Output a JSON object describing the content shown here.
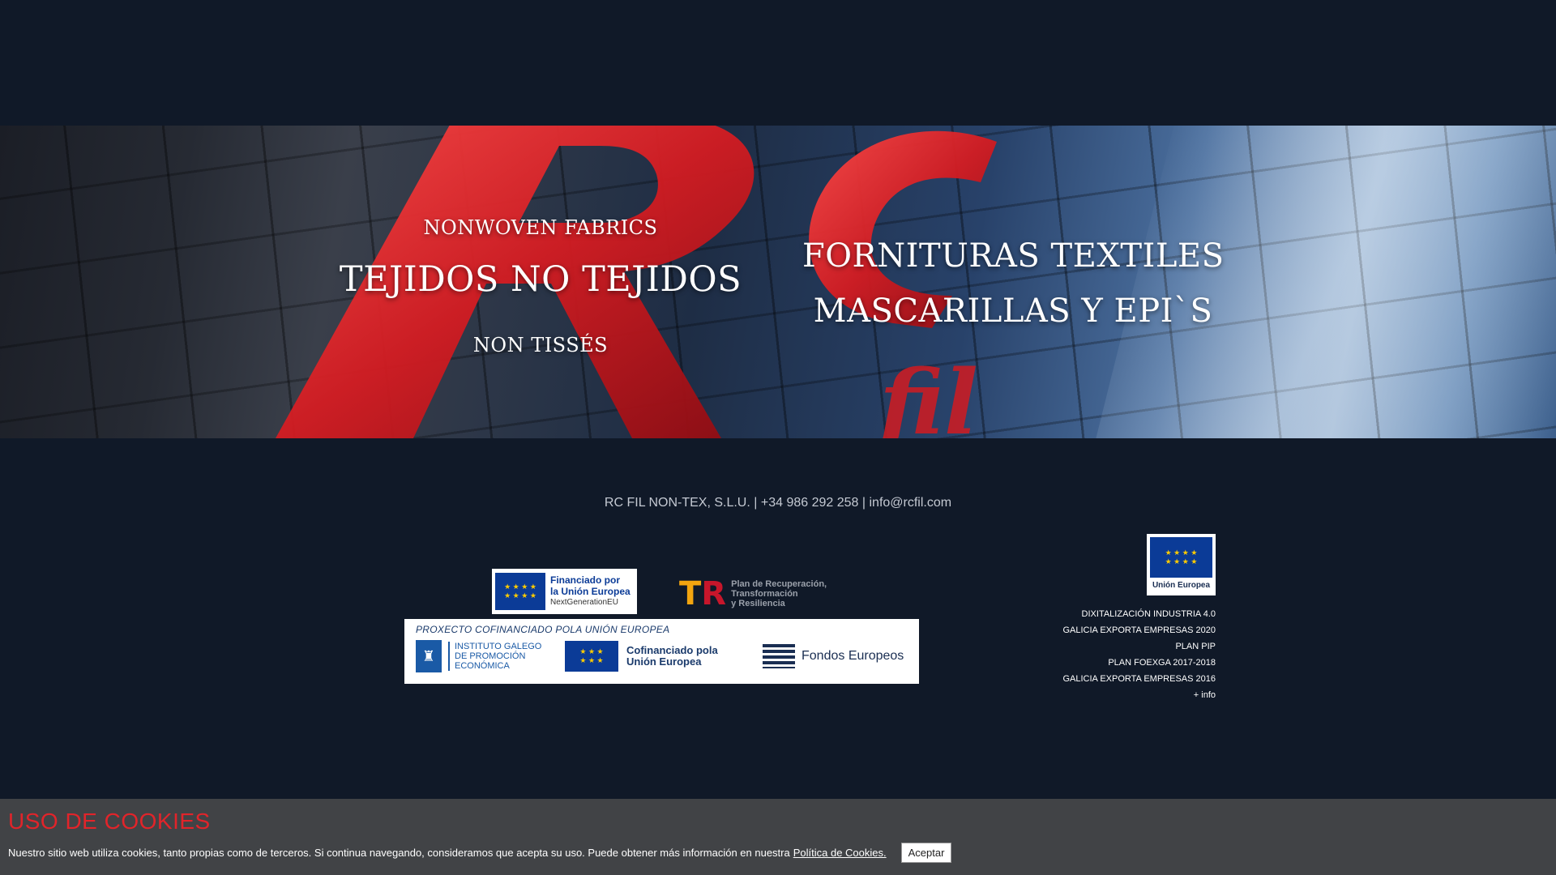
{
  "hero": {
    "nonwoven": "NONWOVEN FABRICS",
    "tejidos": "TEJIDOS NO TEJIDOS",
    "non_tisses": "NON TISSÉS",
    "forn_textiles": "FORNITURAS TEXTILES",
    "mascarillas": "MASCARILLAS Y EPI`S",
    "brand_mark": "RC fil"
  },
  "contact": {
    "company": "RC FIL NON-TEX, S.L.U.",
    "separator": "|",
    "phone": "+34 986 292 258",
    "email": "info@rcfil.com"
  },
  "logos": {
    "ngeu": {
      "line1": "Financiado por",
      "line2": "la Unión Europea",
      "line3": "NextGenerationEU"
    },
    "prtr": {
      "line1": "Plan de Recuperación,",
      "line2": "Transformación",
      "line3": "y Resiliencia"
    },
    "igape": {
      "header": "PROXECTO COFINANCIADO POLA UNIÓN EUROPEA",
      "ig_line1": "INSTITUTO GALEGO",
      "ig_line2": "DE PROMOCIÓN",
      "ig_line3": "ECONÓMICA",
      "cof_line1": "Cofinanciado pola",
      "cof_line2": "Unión Europea",
      "fondos": "Fondos Europeos"
    },
    "ue": {
      "label": "Unión Europea"
    }
  },
  "projects": [
    "DIXITALIZACIÓN INDUSTRIA 4.0",
    "GALICIA EXPORTA EMPRESAS 2020",
    "PLAN PIP",
    "PLAN FOEXGA 2017-2018",
    "GALICIA EXPORTA EMPRESAS 2016",
    "+ info"
  ],
  "cookies": {
    "title": "USO DE COOKIES",
    "message": "Nuestro sitio web utiliza cookies, tanto propias como de terceros. Si continua navegando, consideramos que acepta su uso. Puede obtener más información en nuestra",
    "policy_link": "Política de Cookies.",
    "accept": "Aceptar"
  },
  "colors": {
    "page_bg": "#101928",
    "cookie_bg": "#414346",
    "cookie_title": "#e1242a",
    "brand_red": "#d4202a"
  }
}
